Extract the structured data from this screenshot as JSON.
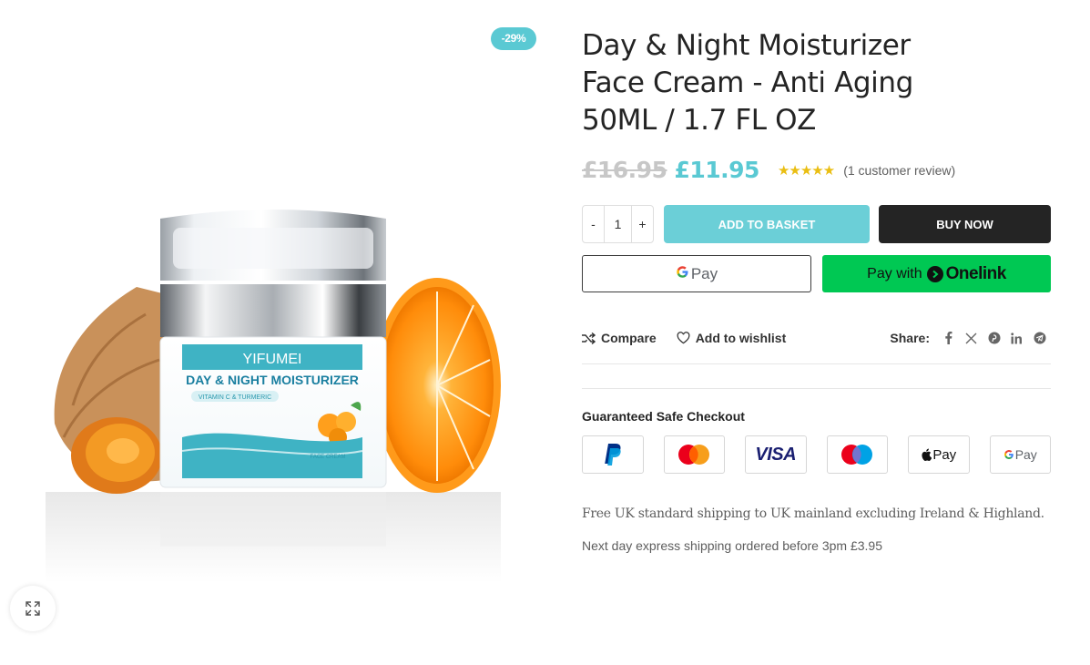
{
  "gallery": {
    "badge": "-29%",
    "image_label": "YIFUMEI",
    "image_subtitle": "DAY & NIGHT MOISTURIZER",
    "image_tag": "VITAMIN C & TURMERIC",
    "image_caption": "FACE CREAM"
  },
  "product": {
    "title": "Day & Night Moisturizer Face Cream - Anti Aging 50ML / 1.7 FL OZ",
    "price_old": "£16.95",
    "price_new": "£11.95",
    "rating": 5,
    "stars": "★★★★★",
    "review_text": "(1 customer review)"
  },
  "cart": {
    "minus": "-",
    "quantity": "1",
    "plus": "+",
    "add_to_basket": "ADD TO BASKET",
    "buy_now": "BUY NOW"
  },
  "express": {
    "gpay_text": "Pay",
    "onelink_prefix": "Pay with",
    "onelink_brand": "Onelink"
  },
  "meta": {
    "compare": "Compare",
    "wishlist": "Add to wishlist",
    "share_label": "Share:",
    "share_icons": [
      "facebook-icon",
      "x-icon",
      "pinterest-icon",
      "linkedin-icon",
      "telegram-icon"
    ]
  },
  "checkout": {
    "title": "Guaranteed Safe Checkout",
    "methods": [
      "PayPal",
      "Mastercard",
      "Visa",
      "Maestro",
      "Apple Pay",
      "Google Pay"
    ],
    "visa_text": "VISA",
    "applepay_text": "Pay",
    "googlepay_text": "Pay"
  },
  "shipping": {
    "line1": "Free UK standard shipping to UK mainland excluding Ireland & Highland.",
    "line2": "Next day express shipping ordered before 3pm £3.95"
  },
  "colors": {
    "accent": "#5ac9d3",
    "basket_button": "#6bcfd7",
    "buy_now": "#242424",
    "onelink": "#00c853",
    "stars": "#eabe12"
  }
}
